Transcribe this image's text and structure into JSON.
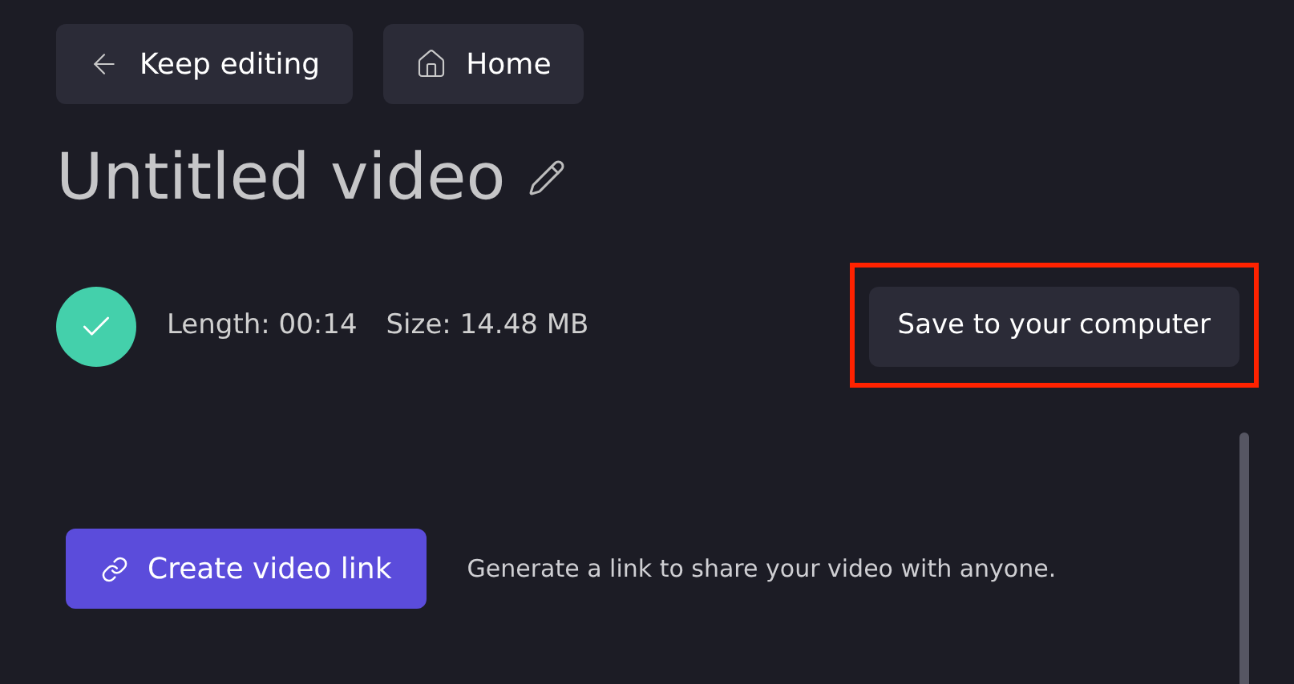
{
  "nav_buttons": [
    {
      "kind": "back",
      "label": "Keep editing"
    },
    {
      "kind": "home",
      "label": "Home"
    }
  ],
  "title": "Untitled video",
  "export": {
    "done": true,
    "length": "Length: 00:14",
    "size": "Size: 14.48 MB"
  },
  "save_button": {
    "label": "Save to your computer",
    "highlighted": true
  },
  "share": {
    "button": "Create video link",
    "description": "Generate a link to share your video with anyone."
  }
}
